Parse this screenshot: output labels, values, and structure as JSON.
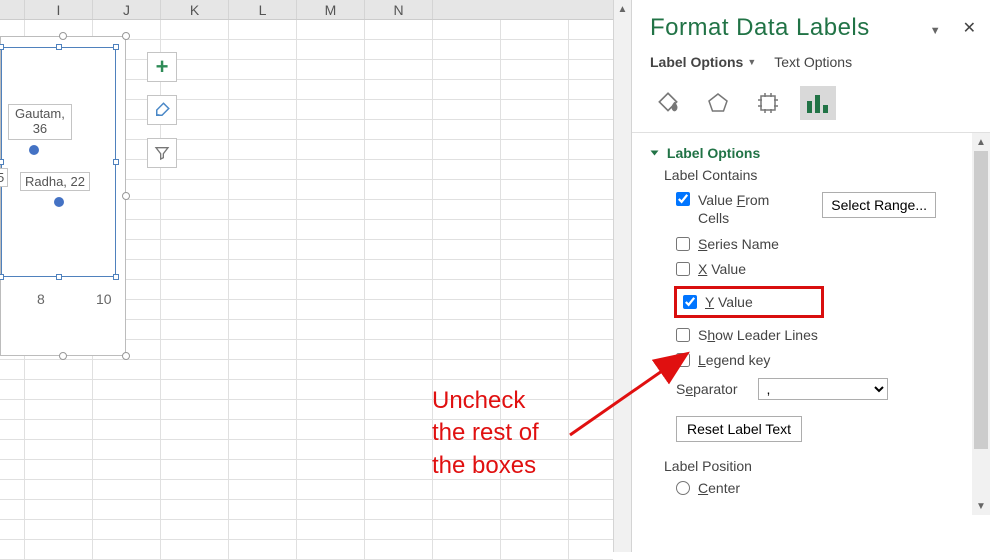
{
  "columns": [
    "I",
    "J",
    "K",
    "L",
    "M",
    "N"
  ],
  "chart": {
    "labels": {
      "gautam": "Gautam, 36",
      "radha": "Radha, 22",
      "partial": "5"
    },
    "axis": {
      "x8": "8",
      "x10": "10"
    }
  },
  "chart_buttons": {
    "plus": "+",
    "brush": "",
    "filter": ""
  },
  "pane": {
    "title": "Format Data Labels",
    "close": "✕",
    "tabs": {
      "label_options": "Label Options",
      "text_options": "Text Options"
    },
    "section": "Label Options",
    "label_contains": "Label Contains",
    "value_from_cells": "Value From Cells",
    "select_range": "Select Range...",
    "series_name": "Series Name",
    "x_value": "X Value",
    "y_value": "Y Value",
    "show_leader": "Show Leader Lines",
    "legend_key": "Legend key",
    "separator": "Separator",
    "separator_value": ", ",
    "reset": "Reset Label Text",
    "label_position": "Label Position",
    "center": "Center"
  },
  "annotation": "Uncheck\nthe rest of\nthe boxes"
}
